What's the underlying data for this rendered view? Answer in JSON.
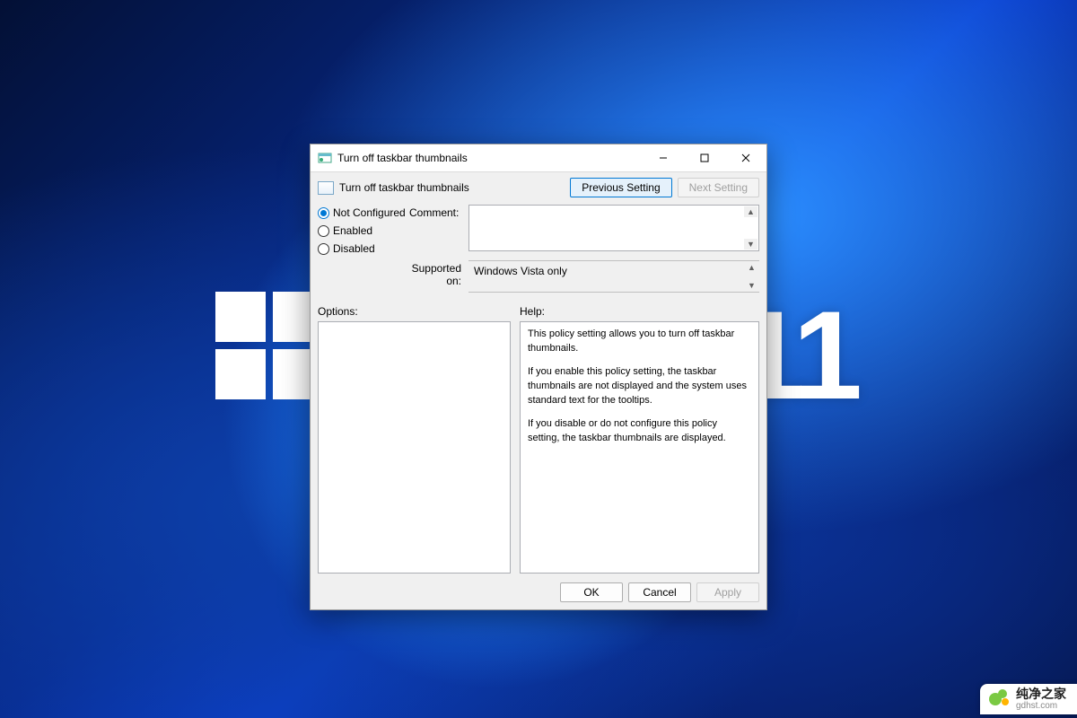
{
  "wallpaper": {
    "brand_text": "11"
  },
  "watermark": {
    "name_cn": "纯净之家",
    "url": "gdhst.com"
  },
  "window": {
    "title": "Turn off taskbar thumbnails",
    "controls": {
      "min": "—",
      "max": "☐",
      "close": "✕"
    },
    "policy_title": "Turn off taskbar thumbnails",
    "nav": {
      "previous": "Previous Setting",
      "next": "Next Setting"
    },
    "state": {
      "not_configured": "Not Configured",
      "enabled": "Enabled",
      "disabled": "Disabled",
      "selected": "not_configured"
    },
    "labels": {
      "comment": "Comment:",
      "supported_on": "Supported on:",
      "options": "Options:",
      "help": "Help:"
    },
    "comment_value": "",
    "supported_on_value": "Windows Vista only",
    "options_value": "",
    "help_paragraphs": [
      "This policy setting allows you to turn off taskbar thumbnails.",
      "If you enable this policy setting, the taskbar thumbnails are not displayed and the system uses standard text for the tooltips.",
      "If you disable or do not configure this policy setting, the taskbar thumbnails are displayed."
    ],
    "footer": {
      "ok": "OK",
      "cancel": "Cancel",
      "apply": "Apply"
    }
  }
}
